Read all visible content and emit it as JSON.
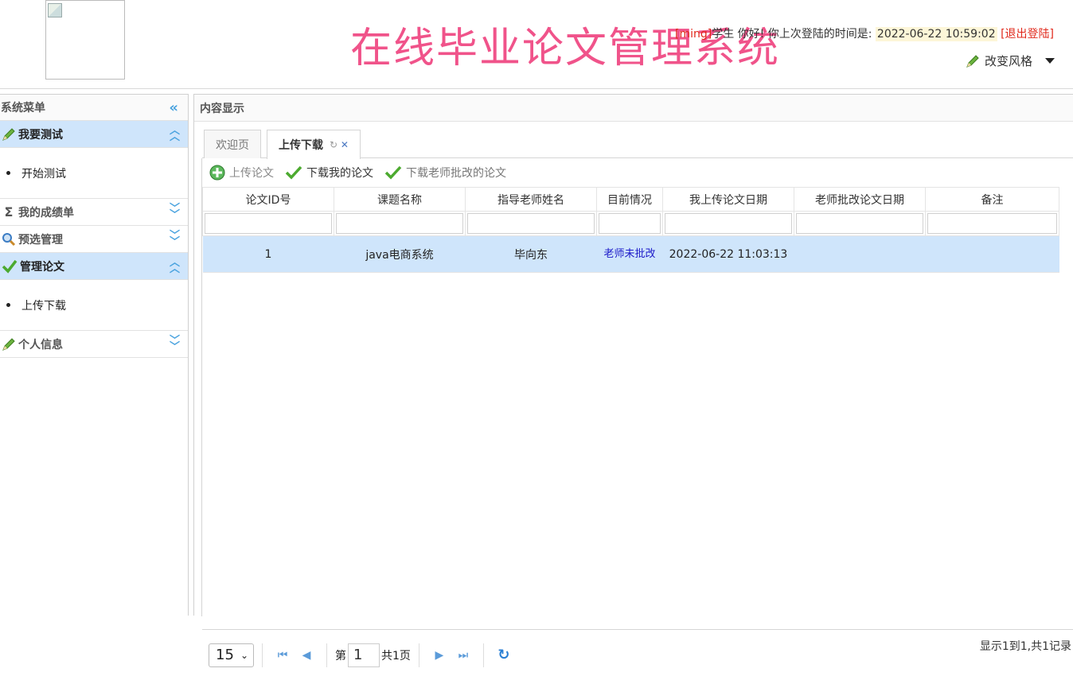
{
  "header": {
    "title": "在线毕业论文管理系统",
    "user_bracket": "[ming]",
    "user_text": "学生 你好! 你上次登陆的时间是:",
    "last_login": "2022-06-22 10:59:02",
    "logout": "[退出登陆]",
    "style_switch": "改变风格"
  },
  "sidebar": {
    "title": "系统菜单",
    "groups": [
      {
        "label": "我要测试",
        "icon": "pencil-icon",
        "items": [
          "开始测试"
        ]
      },
      {
        "label": "我的成绩单",
        "icon": "sigma-icon",
        "items": []
      },
      {
        "label": "预选管理",
        "icon": "search-icon",
        "items": []
      },
      {
        "label": "管理论文",
        "icon": "check-icon",
        "items": [
          "上传下载"
        ]
      },
      {
        "label": "个人信息",
        "icon": "pencil-icon",
        "items": []
      }
    ]
  },
  "content": {
    "title": "内容显示",
    "tabs": [
      "欢迎页",
      "上传下载"
    ],
    "toolbar": [
      "上传论文",
      "下载我的论文",
      "下载老师批改的论文"
    ],
    "columns": [
      "论文ID号",
      "课题名称",
      "指导老师姓名",
      "目前情况",
      "我上传论文日期",
      "老师批改论文日期",
      "备注"
    ],
    "rows": [
      {
        "id": "1",
        "topic": "java电商系统",
        "teacher": "毕向东",
        "status": "老师未批改",
        "upload_date": "2022-06-22 11:03:13",
        "review_date": "",
        "note": ""
      }
    ]
  },
  "pager": {
    "page_size": "15",
    "page_prefix": "第",
    "page_current": "1",
    "page_total": "共1页",
    "summary": "显示1到1,共1记录"
  }
}
